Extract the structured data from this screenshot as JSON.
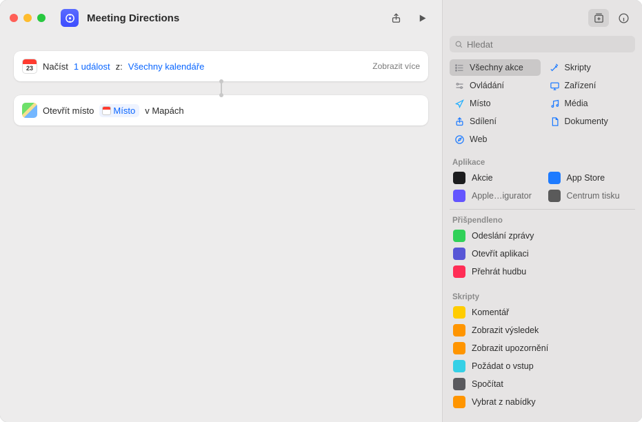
{
  "window": {
    "title": "Meeting Directions"
  },
  "workflow": {
    "action1": {
      "verb": "Načíst",
      "count_label": "1 událost",
      "from_label": "z:",
      "source_label": "Všechny kalendáře",
      "more": "Zobrazit více"
    },
    "action2": {
      "verb": "Otevřít místo",
      "pill_label": "Místo",
      "suffix": "v Mapách"
    }
  },
  "search": {
    "placeholder": "Hledat"
  },
  "categories": [
    {
      "label": "Všechny akce",
      "icon": "list",
      "color": "#8e8e93",
      "selected": true
    },
    {
      "label": "Skripty",
      "icon": "wand",
      "color": "#1e7bff"
    },
    {
      "label": "Ovládání",
      "icon": "sliders",
      "color": "#8e8e93"
    },
    {
      "label": "Zařízení",
      "icon": "display",
      "color": "#1e7bff"
    },
    {
      "label": "Místo",
      "icon": "location",
      "color": "#1badff"
    },
    {
      "label": "Média",
      "icon": "music",
      "color": "#1e7bff"
    },
    {
      "label": "Sdílení",
      "icon": "share",
      "color": "#1e7bff"
    },
    {
      "label": "Dokumenty",
      "icon": "doc",
      "color": "#1e7bff"
    },
    {
      "label": "Web",
      "icon": "safari",
      "color": "#1e7bff"
    }
  ],
  "sections": {
    "apps_title": "Aplikace",
    "apps": [
      {
        "label": "Akcie",
        "color": "#1c1c1e"
      },
      {
        "label": "App Store",
        "color": "#1e7bff"
      },
      {
        "label": "Apple…igurator",
        "color": "#6455ff"
      },
      {
        "label": "Centrum tisku",
        "color": "#5a5a5a"
      }
    ],
    "pinned_title": "Přišpendleno",
    "pinned": [
      {
        "label": "Odeslání zprávy",
        "color": "#30d158"
      },
      {
        "label": "Otevřít aplikaci",
        "color": "#5856d6"
      },
      {
        "label": "Přehrát hudbu",
        "color": "#ff2d55"
      }
    ],
    "scripts_title": "Skripty",
    "scripts": [
      {
        "label": "Komentář",
        "color": "#ffcc00"
      },
      {
        "label": "Zobrazit výsledek",
        "color": "#ff9500"
      },
      {
        "label": "Zobrazit upozornění",
        "color": "#ff9500"
      },
      {
        "label": "Požádat o vstup",
        "color": "#35d0e6"
      },
      {
        "label": "Spočítat",
        "color": "#5a5a5e"
      },
      {
        "label": "Vybrat z nabídky",
        "color": "#ff9500"
      }
    ]
  }
}
